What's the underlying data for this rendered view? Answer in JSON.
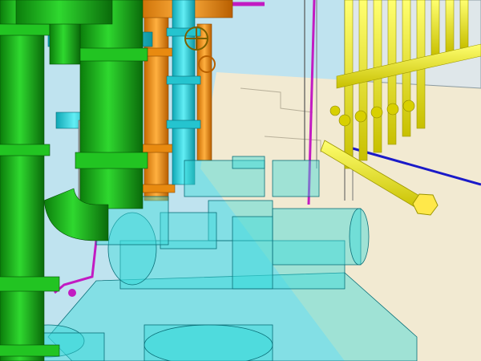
{
  "scene": {
    "description_label": "",
    "colors": {
      "sky": "#bfe3ef",
      "floor": "#f2ead2",
      "green_pipe": "#1fbf1f",
      "green_dark": "#0c7a0c",
      "orange_pipe": "#f39a1a",
      "cyan_pipe": "#2ad0dc",
      "yellow_pipe": "#e8e020",
      "magenta_line": "#c21bc2",
      "blue_line": "#1a1ac8",
      "translucent_equipment": "#39d9d9",
      "grey_pipe": "#c9c9c9"
    },
    "objects": [
      {
        "name": "green-pipe-left",
        "color": "green_pipe"
      },
      {
        "name": "green-pipe-center",
        "color": "green_pipe"
      },
      {
        "name": "orange-pipe",
        "color": "orange_pipe"
      },
      {
        "name": "cyan-pipe",
        "color": "cyan_pipe"
      },
      {
        "name": "yellow-manifold",
        "color": "yellow_pipe"
      },
      {
        "name": "pump-skid",
        "color": "translucent_equipment"
      }
    ]
  }
}
